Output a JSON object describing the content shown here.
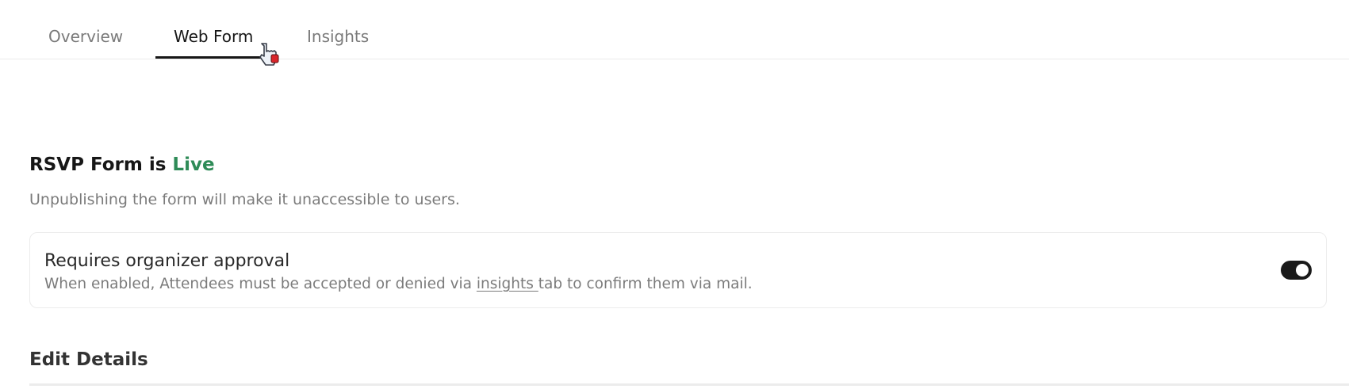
{
  "tabs": {
    "overview": "Overview",
    "web_form": "Web Form",
    "insights": "Insights",
    "active": "Web Form"
  },
  "form_status": {
    "title_prefix": "RSVP Form is ",
    "status": "Live",
    "status_color": "#2e8b57",
    "subtitle": "Unpublishing the form will make it unaccessible to users."
  },
  "approval": {
    "title": "Requires organizer approval",
    "desc_before": "When enabled, Attendees must be accepted or denied via ",
    "desc_link": "insights ",
    "desc_after": "tab to confirm them via mail.",
    "toggle_on": true
  },
  "edit_details": {
    "title": "Edit Details"
  },
  "icons": {
    "cursor": "hand-pointer-icon"
  }
}
